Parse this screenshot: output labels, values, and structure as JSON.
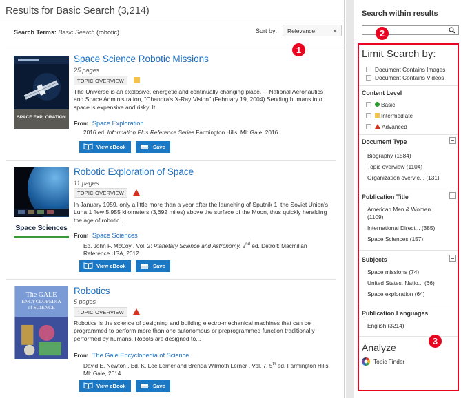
{
  "main": {
    "results_header": "Results for Basic Search (3,214)",
    "search_terms_label": "Search Terms:",
    "search_terms_type": "Basic Search",
    "search_terms_value": "(robotic)",
    "sort_label": "Sort by:",
    "sort_value": "Relevance",
    "badge_1": "1"
  },
  "results": [
    {
      "title": "Space Science Robotic Missions",
      "pages": "25 pages",
      "tag": "TOPIC OVERVIEW",
      "level": "intermediate",
      "description": "The Universe is an explosive, energetic and continually changing place. —National Aeronautics and Space Administration, \"Chandra's X-Ray Vision\" (February 19, 2004) Sending humans into space is expensive and risky. It...",
      "from_label": "From",
      "source": "Space Exploration",
      "citation_pre": "2016 ed.",
      "citation_series": "Information Plus Reference Series",
      "citation_post": "Farmington Hills, MI: Gale, 2016.",
      "thumb_title": "SPACE EXPLORATION",
      "view_label": "View eBook",
      "save_label": "Save"
    },
    {
      "title": "Robotic Exploration of Space",
      "pages": "11 pages",
      "tag": "TOPIC OVERVIEW",
      "level": "advanced",
      "description": "In January 1959, only a little more than a year after the launching of Sputnik 1, the Soviet Union's Luna 1 flew 5,955 kilometers (3,692 miles) above the surface of the Moon, thus quickly heralding the age of robotic...",
      "from_label": "From",
      "source": "Space Sciences",
      "citation_pre": "Ed. John F. McCoy . Vol. 2:",
      "citation_series": "Planetary Science and Astronomy.",
      "citation_edition_num": "2",
      "citation_edition_sup": "nd",
      "citation_post": "ed. Detroit: Macmillan Reference USA, 2012.",
      "thumb_title": "Space Sciences",
      "view_label": "View eBook",
      "save_label": "Save"
    },
    {
      "title": "Robotics",
      "pages": "5 pages",
      "tag": "TOPIC OVERVIEW",
      "level": "advanced",
      "description": "Robotics is the science of designing and building electro-mechanical machines that can be programmed to perform more than one autonomous or preprogrammed function traditionally performed by humans. Robots are designed to...",
      "from_label": "From",
      "source": "The Gale Encyclopedia of Science",
      "citation_pre": "David E. Newton . Ed. K. Lee Lerner and Brenda Wilmoth Lerner . Vol. 7.",
      "citation_edition_num": "5",
      "citation_edition_sup": "th",
      "citation_post": "ed. Farmington Hills, MI: Gale, 2014.",
      "thumb_title_1": "The GALE",
      "thumb_title_2": "ENCYCLOPEDIA",
      "thumb_title_3": "of SCIENCE",
      "view_label": "View eBook",
      "save_label": "Save"
    }
  ],
  "sidebar": {
    "within_title": "Search within results",
    "badge_2": "2",
    "limit_title": "Limit Search by:",
    "contains_images": "Document Contains Images",
    "contains_videos": "Document Contains Videos",
    "content_level_title": "Content Level",
    "levels": [
      "Basic",
      "Intermediate",
      "Advanced"
    ],
    "doc_type_title": "Document Type",
    "doc_types": [
      "Biography (1584)",
      "Topic overview (1104)",
      "Organization overvie... (131)"
    ],
    "pub_title_title": "Publication Title",
    "pub_titles": [
      "American Men & Women...",
      "(1109)",
      "International Direct... (385)",
      "Space Sciences (157)"
    ],
    "subjects_title": "Subjects",
    "subjects": [
      "Space missions (74)",
      "United States. Natio... (66)",
      "Space exploration (64)"
    ],
    "pub_lang_title": "Publication Languages",
    "pub_langs": [
      "English (3214)"
    ],
    "analyze_title": "Analyze",
    "badge_3": "3",
    "topic_finder": "Topic Finder"
  },
  "colors": {
    "link_blue": "#1a6ec1",
    "button_blue": "#1a78c4",
    "highlight_red": "#e8051f",
    "level_basic": "#2d9b2d",
    "level_intermediate": "#f5c34c",
    "level_advanced": "#d6311f"
  }
}
